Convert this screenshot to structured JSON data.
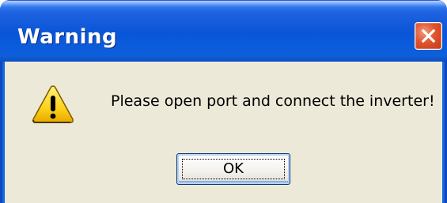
{
  "window": {
    "title": "Warning",
    "close_icon": "close-icon",
    "accent_color": "#0a55d8",
    "close_color": "#e0542e"
  },
  "dialog": {
    "icon": "warning-icon",
    "message": "Please open port and connect the inverter!",
    "ok_label": "OK"
  }
}
